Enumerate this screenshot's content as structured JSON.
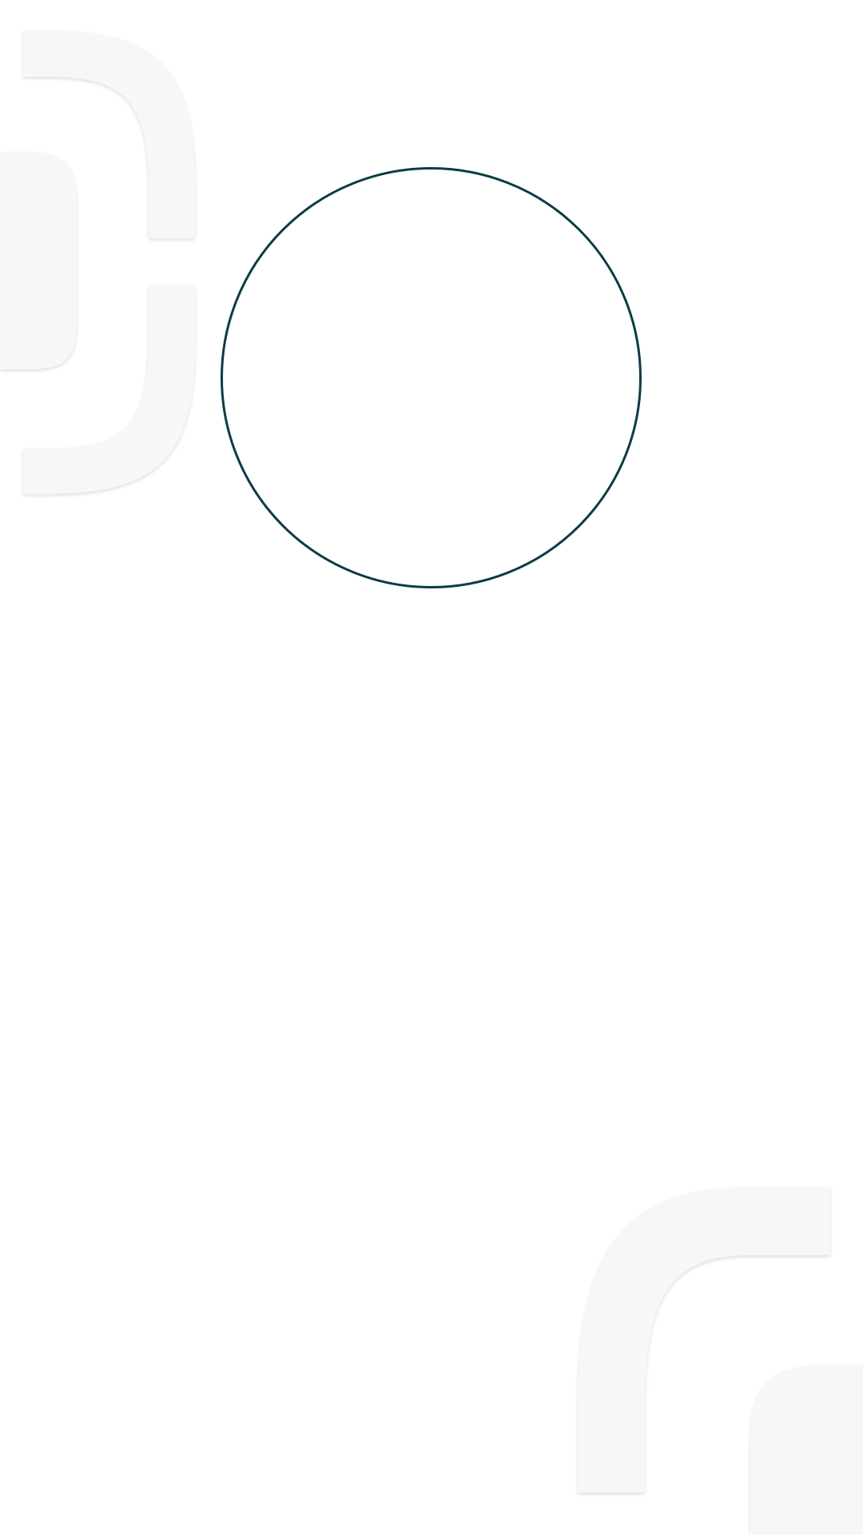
{
  "theme": {
    "background": "#ffffff",
    "ring_color": "#0d3b45",
    "decor_fill": "#f7f7f7",
    "decor_shadow": "#e6e6e6"
  },
  "decor": {
    "top_left_icon": "brand-watermark-shape",
    "bottom_right_icon": "brand-watermark-shape"
  },
  "avatar": {
    "icon": "empty-circle"
  }
}
